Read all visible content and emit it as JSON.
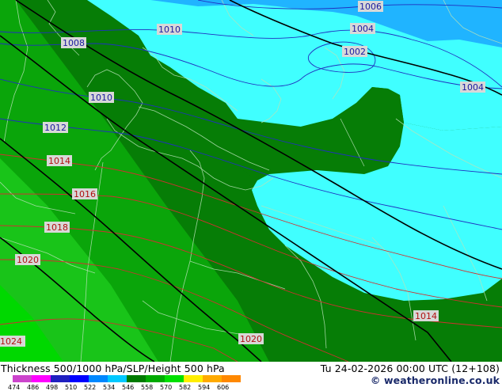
{
  "map": {
    "isobar_labels": [
      {
        "text": "1006"
      },
      {
        "text": "1004"
      },
      {
        "text": "1002"
      },
      {
        "text": "1004"
      },
      {
        "text": "1010"
      },
      {
        "text": "1008"
      },
      {
        "text": "1010"
      },
      {
        "text": "1012"
      },
      {
        "text": "1014"
      },
      {
        "text": "1016"
      },
      {
        "text": "1018"
      },
      {
        "text": "1020"
      },
      {
        "text": "1024"
      },
      {
        "text": "1020"
      },
      {
        "text": "1014"
      }
    ]
  },
  "footer": {
    "title": "Thickness 500/1000 hPa/SLP/Height 500 hPa",
    "datetime": "Tu 24-02-2026 00:00 UTC (12+108)",
    "credit": "© weatheronline.co.uk",
    "scale": {
      "labels": [
        "474",
        "486",
        "498",
        "510",
        "522",
        "534",
        "546",
        "558",
        "570",
        "582",
        "594",
        "606"
      ],
      "colors": [
        "#cc44cc",
        "#ff00ff",
        "#2020c0",
        "#0000ff",
        "#0088ff",
        "#00c8ff",
        "#007a00",
        "#00aa00",
        "#00e000",
        "#ffee00",
        "#ffaa00",
        "#ff8800"
      ]
    }
  },
  "colors": {
    "dark_green": "#067d06",
    "mid_green": "#0aa50a",
    "light_green": "#00cc00",
    "cyan": "#40ffff",
    "light_blue": "#20b4ff"
  }
}
